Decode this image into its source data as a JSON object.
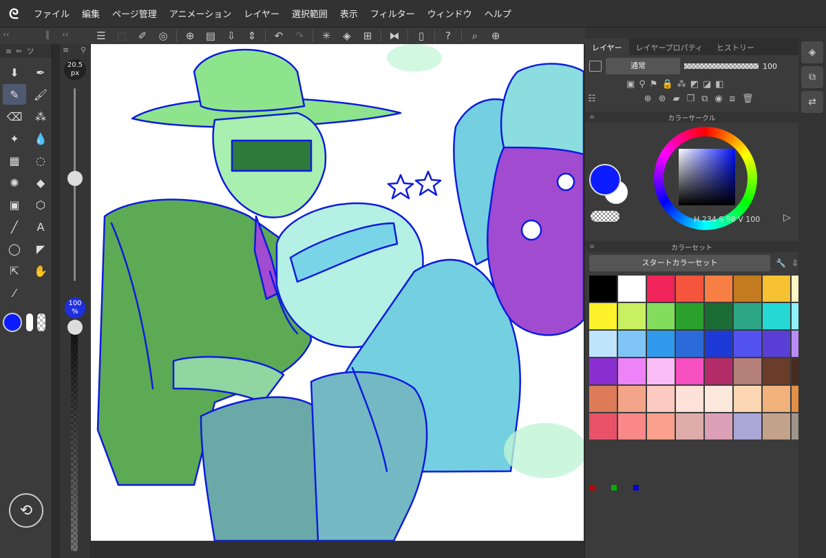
{
  "menu": [
    "ファイル",
    "編集",
    "ページ管理",
    "アニメーション",
    "レイヤー",
    "選択範囲",
    "表示",
    "フィルター",
    "ウィンドウ",
    "ヘルプ"
  ],
  "logo_glyph": "ᘓ",
  "command_icons": [
    "menu-icon",
    "new-canvas-icon",
    "image-edit-icon",
    "spiral-icon",
    "new-page-icon",
    "open-folder-icon",
    "save-icon",
    "undo-icon",
    "redo-icon",
    "loading-icon",
    "fill-icon",
    "transform-icon",
    "flip-icon",
    "device-icon",
    "help-icon",
    "zoom-icon",
    "add-page-icon"
  ],
  "tool_header": "ツ",
  "tools": [
    {
      "name": "sub-tool-icon",
      "glyph": "⬇"
    },
    {
      "name": "pen-icon",
      "glyph": "✒",
      "active": false
    },
    {
      "name": "pencil-icon",
      "glyph": "✎",
      "active": true
    },
    {
      "name": "brush-icon",
      "glyph": "🖌"
    },
    {
      "name": "eraser-icon",
      "glyph": "⌫"
    },
    {
      "name": "spray-icon",
      "glyph": "⁂"
    },
    {
      "name": "sparkle-icon",
      "glyph": "✦"
    },
    {
      "name": "blend-icon",
      "glyph": "💧"
    },
    {
      "name": "mesh-icon",
      "glyph": "▦"
    },
    {
      "name": "lasso-icon",
      "glyph": "◌"
    },
    {
      "name": "magic-wand-icon",
      "glyph": "✺"
    },
    {
      "name": "fill-bucket-icon",
      "glyph": "◆"
    },
    {
      "name": "gradient-icon",
      "glyph": "▣"
    },
    {
      "name": "shape-icon",
      "glyph": "⬡"
    },
    {
      "name": "line-icon",
      "glyph": "╱"
    },
    {
      "name": "text-icon",
      "glyph": "A"
    },
    {
      "name": "balloon-icon",
      "glyph": "◯"
    },
    {
      "name": "frame-icon",
      "glyph": "◤"
    },
    {
      "name": "move-icon",
      "glyph": "⇱"
    },
    {
      "name": "hand-icon",
      "glyph": "✋"
    },
    {
      "name": "eyedropper-icon",
      "glyph": "⁄"
    }
  ],
  "brush_size": {
    "value": "20.5",
    "unit": "px"
  },
  "opacity": {
    "value": "100",
    "unit": "%"
  },
  "layer_panel": {
    "tabs": [
      "レイヤー",
      "レイヤープロパティ",
      "ヒストリー"
    ],
    "blend_mode": "通常",
    "opacity": "100"
  },
  "color_circle": {
    "title": "カラーサークル",
    "H": "234",
    "S": "98",
    "V": "100",
    "h_label": "H",
    "s_label": "S",
    "v_label": "V",
    "main_color": "#0c1bff"
  },
  "color_set": {
    "title": "カラーセット",
    "name": "スタートカラーセット",
    "colors": [
      "#000000",
      "#ffffff",
      "#f0245a",
      "#f5553c",
      "#f77f43",
      "#c47a1e",
      "#f6c232",
      "#fdf7c4",
      "#fef32a",
      "#c8f060",
      "#83dc5c",
      "#2ca02c",
      "#1b6b35",
      "#2da785",
      "#25d8d4",
      "#8ef2fc",
      "#bde4fb",
      "#7fc6f6",
      "#2f9aeb",
      "#2b6bd9",
      "#1e3ad6",
      "#5252f0",
      "#5a3fd7",
      "#b98cf5",
      "#8a2ed0",
      "#ee82f8",
      "#fbbdf8",
      "#f54fc0",
      "#b42c67",
      "#b47e79",
      "#6b3c2a",
      "#472c1e",
      "#dd7a58",
      "#f4a488",
      "#fdcac2",
      "#fee1d8",
      "#fde9dc",
      "#fdd7b3",
      "#f1b27c",
      "#e38f47",
      "#e85268",
      "#fb8888",
      "#fba08c",
      "#ddaba8",
      "#dca0b6",
      "#aaa6d6",
      "#c3a28a",
      "#9d958b"
    ]
  },
  "canvas_scene": {
    "background": "#ffffff"
  }
}
